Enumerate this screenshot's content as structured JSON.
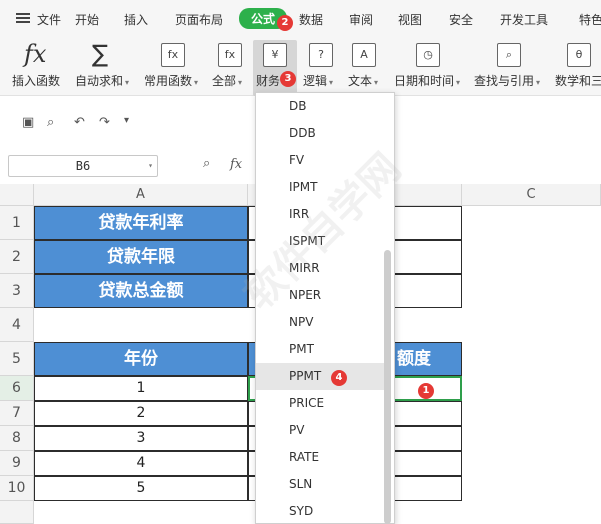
{
  "menubar": {
    "file": "文件",
    "tabs": [
      "开始",
      "插入",
      "页面布局",
      "公式",
      "数据",
      "审阅",
      "视图",
      "安全",
      "开发工具",
      "特色"
    ],
    "active_tab": "公式"
  },
  "ribbon": {
    "insert_function": "插入函数",
    "autosum": "自动求和",
    "common_functions": "常用函数",
    "all": "全部",
    "finance": "财务",
    "logic": "逻辑",
    "text": "文本",
    "datetime": "日期和时间",
    "lookup": "查找与引用",
    "math": "数学和三"
  },
  "badges": [
    "1",
    "2",
    "3",
    "4"
  ],
  "formula_bar": {
    "name_box": "B6",
    "fx": "fx"
  },
  "sheet": {
    "columns": [
      "A",
      "",
      "C"
    ],
    "rows": [
      "1",
      "2",
      "3",
      "4",
      "5",
      "6",
      "7",
      "8",
      "9",
      "10"
    ],
    "labels": [
      "贷款年利率",
      "贷款年限",
      "贷款总金额"
    ],
    "header_year": "年份",
    "header_amount": "额度",
    "years": [
      "1",
      "2",
      "3",
      "4",
      "5"
    ]
  },
  "finance_dropdown": {
    "items": [
      "DB",
      "DDB",
      "FV",
      "IPMT",
      "IRR",
      "ISPMT",
      "MIRR",
      "NPER",
      "NPV",
      "PMT",
      "PPMT",
      "PRICE",
      "PV",
      "RATE",
      "SLN",
      "SYD"
    ],
    "highlighted": "PPMT"
  },
  "watermark": "软件自学网"
}
